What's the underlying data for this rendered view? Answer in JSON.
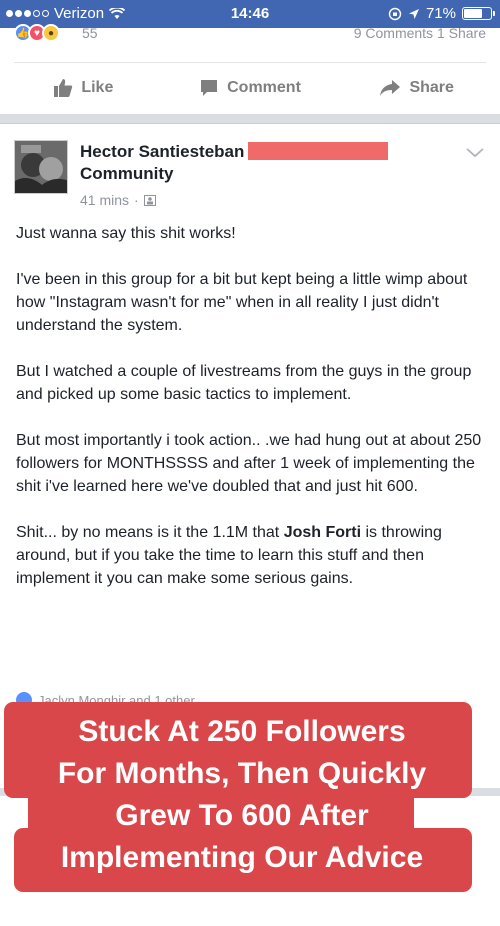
{
  "status_bar": {
    "carrier": "Verizon",
    "time": "14:46",
    "battery": "71%",
    "battery_level": 0.71
  },
  "reactions_bar": {
    "count": "55",
    "stats": "9 Comments  1 Share"
  },
  "actions": {
    "like": "Like",
    "comment": "Comment",
    "share": "Share"
  },
  "post": {
    "author_line1": "Hector Santiesteban",
    "author_line2": "Community",
    "time": "41 mins",
    "separator": "·",
    "paragraphs": [
      "Just wanna say this shit works!",
      "I've been in this group for a bit but kept being a little wimp about how \"Instagram wasn't for me\" when in all reality I just didn't understand the system.",
      "But I watched a couple of livestreams from the guys in the group and picked up some basic tactics to implement.",
      "But most importantly i took action.. .we had hung out at about 250 followers for MONTHSSSS and after 1 week of implementing the shit i've learned here we've doubled that and just hit 600."
    ],
    "last_paragraph": {
      "before": "Shit... by no means is it the 1.1M that ",
      "mention": "Josh Forti",
      "after": " is throwing around, but if you take the time to learn this stuff and then implement it you can make some serious gains."
    },
    "likers": "Jaclyn Monghir and 1 other"
  },
  "caption": {
    "line1": "Stuck At 250 Followers",
    "line2": "For Months, Then Quickly",
    "line3": "Grew To 600 After",
    "line4": "Implementing Our Advice"
  },
  "colors": {
    "status_bar": "#4267b2",
    "caption_bg": "#d9474a",
    "redaction": "#f06a6a"
  }
}
